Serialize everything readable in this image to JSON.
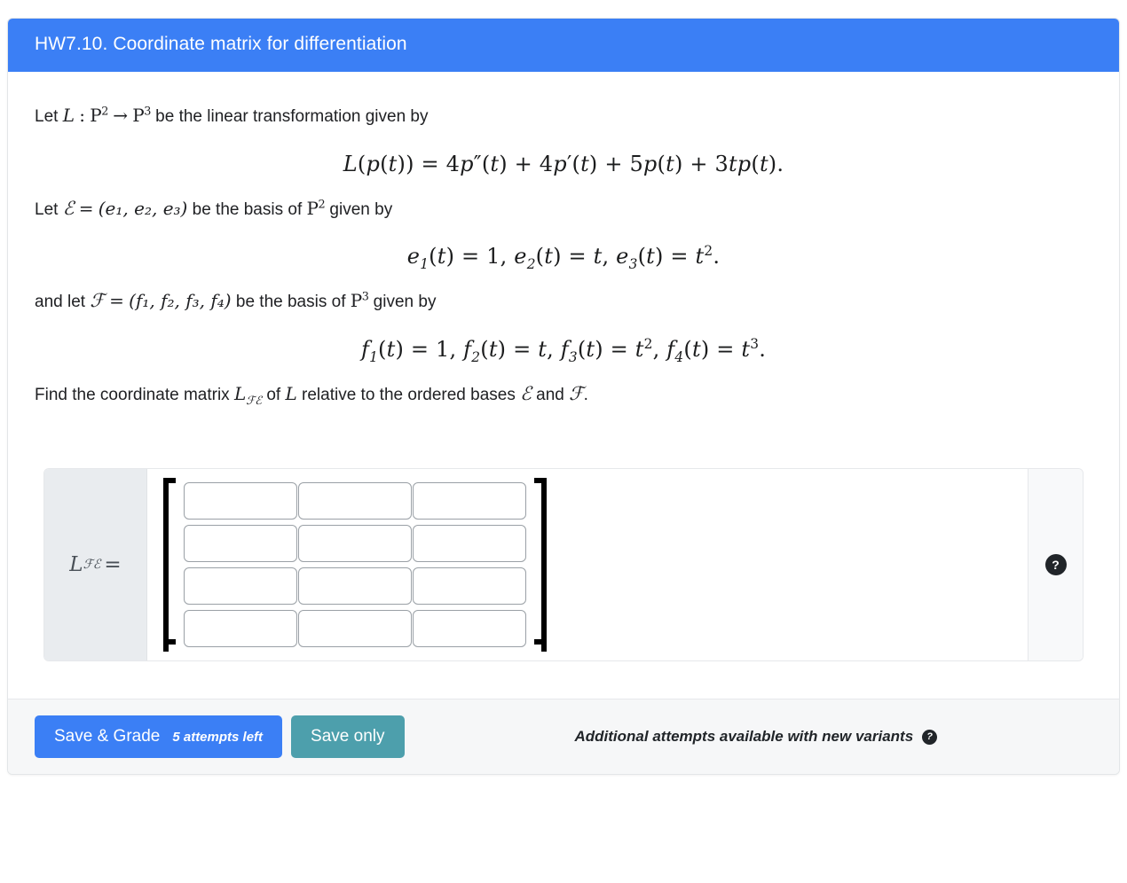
{
  "header": {
    "title": "HW7.10. Coordinate matrix for differentiation",
    "background": "#3b7ff5"
  },
  "problem": {
    "line1_prefix": "Let",
    "line1_L": "L",
    "line1_colon": ":",
    "line1_domain": "P",
    "line1_domain_exp": "2",
    "line1_arrow": "→",
    "line1_codomain": "P",
    "line1_codomain_exp": "3",
    "line1_suffix": "be the linear transformation given by",
    "equation1": "L(p(t)) = 4p″(t) + 4p′(t) + 5p(t) + 3tp(t).",
    "line2_prefix": "Let",
    "line2_E": "ℰ",
    "line2_eq": "=",
    "line2_tuple": "(e₁, e₂, e₃)",
    "line2_mid": "be the basis of",
    "line2_space": "P",
    "line2_space_exp": "2",
    "line2_suffix": "given by",
    "equation2": "e₁(t) = 1, e₂(t) = t, e₃(t) = t².",
    "line3_prefix": "and let",
    "line3_F": "ℱ",
    "line3_tuple": "(f₁, f₂, f₃, f₄)",
    "line3_mid": "be the basis of",
    "line3_space": "P",
    "line3_space_exp": "3",
    "line3_suffix": "given by",
    "equation3": "f₁(t) = 1, f₂(t) = t, f₃(t) = t², f₄(t) = t³.",
    "line4_prefix": "Find the coordinate matrix",
    "line4_matrix": "L",
    "line4_matrix_sub": "ℱℰ",
    "line4_mid": "of",
    "line4_L": "L",
    "line4_mid2": "relative to the ordered bases",
    "line4_E": "ℰ",
    "line4_and": "and",
    "line4_F": "ℱ",
    "line4_period": "."
  },
  "answer": {
    "label_symbol": "L",
    "label_subscript": "ℱℰ",
    "label_equals": "=",
    "matrix_rows": 4,
    "matrix_cols": 3,
    "cell_placeholder": "",
    "cells": [
      [
        "",
        "",
        ""
      ],
      [
        "",
        "",
        ""
      ],
      [
        "",
        "",
        ""
      ],
      [
        "",
        "",
        ""
      ]
    ],
    "help_icon": "?"
  },
  "footer": {
    "save_grade_label": "Save & Grade",
    "attempts_label": "5 attempts left",
    "save_only_label": "Save only",
    "variants_note": "Additional attempts available with new variants",
    "variants_help_icon": "?",
    "save_grade_color": "#3b7ff5",
    "save_only_color": "#4d9fac",
    "background": "#f6f7f8"
  }
}
